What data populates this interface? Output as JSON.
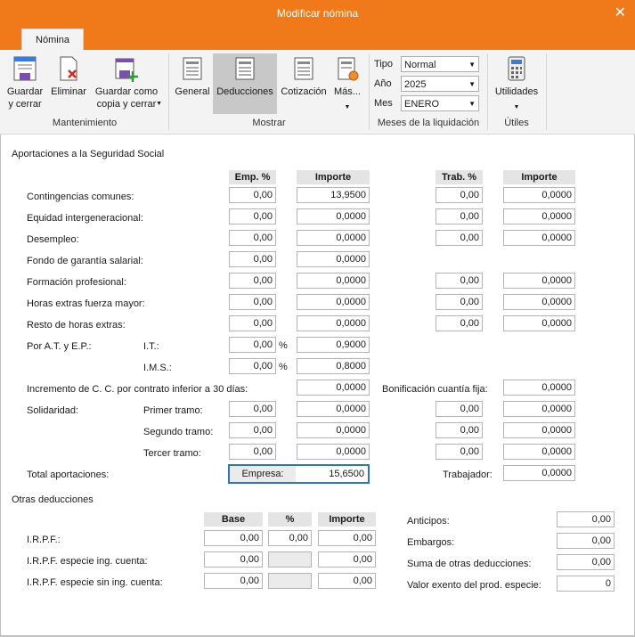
{
  "window": {
    "title": "Modificar nómina"
  },
  "ribbon": {
    "tab": "Nómina",
    "buttons": {
      "guardar_cerrar": "Guardar\ny cerrar",
      "eliminar": "Eliminar",
      "guardar_copia": "Guardar como\ncopia y cerrar",
      "general": "General",
      "deducciones": "Deducciones",
      "cotizacion": "Cotización",
      "mas": "Más...",
      "utilidades": "Utilidades"
    },
    "groups": {
      "mantenimiento": "Mantenimiento",
      "mostrar": "Mostrar",
      "meses": "Meses de la liquidación",
      "utiles": "Útiles"
    },
    "selects": {
      "tipo_label": "Tipo",
      "tipo_value": "Normal",
      "anio_label": "Año",
      "anio_value": "2025",
      "mes_label": "Mes",
      "mes_value": "ENERO"
    }
  },
  "ss": {
    "section_title": "Aportaciones a la Seguridad Social",
    "headers": {
      "emp_pct": "Emp. %",
      "importe1": "Importe",
      "trab_pct": "Trab. %",
      "importe2": "Importe"
    },
    "rows": {
      "contingencias": {
        "label": "Contingencias comunes:",
        "emp": "0,00",
        "imp1": "13,9500",
        "trab": "0,00",
        "imp2": "0,0000"
      },
      "equidad": {
        "label": "Equidad intergeneracional:",
        "emp": "0,00",
        "imp1": "0,0000",
        "trab": "0,00",
        "imp2": "0,0000"
      },
      "desempleo": {
        "label": "Desempleo:",
        "emp": "0,00",
        "imp1": "0,0000",
        "trab": "0,00",
        "imp2": "0,0000"
      },
      "fogasa": {
        "label": "Fondo de garantía salarial:",
        "emp": "0,00",
        "imp1": "0,0000"
      },
      "formacion": {
        "label": "Formación profesional:",
        "emp": "0,00",
        "imp1": "0,0000",
        "trab": "0,00",
        "imp2": "0,0000"
      },
      "horas_fm": {
        "label": "Horas extras fuerza mayor:",
        "emp": "0,00",
        "imp1": "0,0000",
        "trab": "0,00",
        "imp2": "0,0000"
      },
      "resto_horas": {
        "label": "Resto de horas extras:",
        "emp": "0,00",
        "imp1": "0,0000",
        "trab": "0,00",
        "imp2": "0,0000"
      }
    },
    "atep": {
      "label": "Por A.T. y E.P.:",
      "it_label": "I.T.:",
      "it_pct": "0,00",
      "it_imp": "0,9000",
      "ims_label": "I.M.S.:",
      "ims_pct": "0,00",
      "ims_imp": "0,8000",
      "pct_sign": "%"
    },
    "incremento": {
      "label": "Incremento de C. C. por contrato inferior a 30 días:",
      "imp": "0,0000"
    },
    "bonificacion": {
      "label": "Bonificación cuantía fija:",
      "imp": "0,0000"
    },
    "solidaridad": {
      "label": "Solidaridad:",
      "t1": {
        "label": "Primer tramo:",
        "emp": "0,00",
        "imp1": "0,0000",
        "trab": "0,00",
        "imp2": "0,0000"
      },
      "t2": {
        "label": "Segundo tramo:",
        "emp": "0,00",
        "imp1": "0,0000",
        "trab": "0,00",
        "imp2": "0,0000"
      },
      "t3": {
        "label": "Tercer tramo:",
        "emp": "0,00",
        "imp1": "0,0000",
        "trab": "0,00",
        "imp2": "0,0000"
      }
    },
    "total": {
      "label": "Total aportaciones:",
      "empresa_label": "Empresa:",
      "empresa": "15,6500",
      "trabajador_label": "Trabajador:",
      "trabajador": "0,0000"
    }
  },
  "otras": {
    "section_title": "Otras deducciones",
    "headers": {
      "base": "Base",
      "pct": "%",
      "importe": "Importe"
    },
    "irpf": {
      "label": "I.R.P.F.:",
      "base": "0,00",
      "pct": "0,00",
      "imp": "0,00"
    },
    "irpf_ing": {
      "label": "I.R.P.F. especie ing. cuenta:",
      "base": "0,00",
      "pct": "",
      "imp": "0,00"
    },
    "irpf_sin": {
      "label": "I.R.P.F. especie sin ing. cuenta:",
      "base": "0,00",
      "pct": "",
      "imp": "0,00"
    },
    "anticipos": {
      "label": "Anticipos:",
      "value": "0,00"
    },
    "embargos": {
      "label": "Embargos:",
      "value": "0,00"
    },
    "suma": {
      "label": "Suma de otras deducciones:",
      "value": "0,00"
    },
    "valor_exento": {
      "label": "Valor exento del prod. especie:",
      "value": "0"
    }
  }
}
